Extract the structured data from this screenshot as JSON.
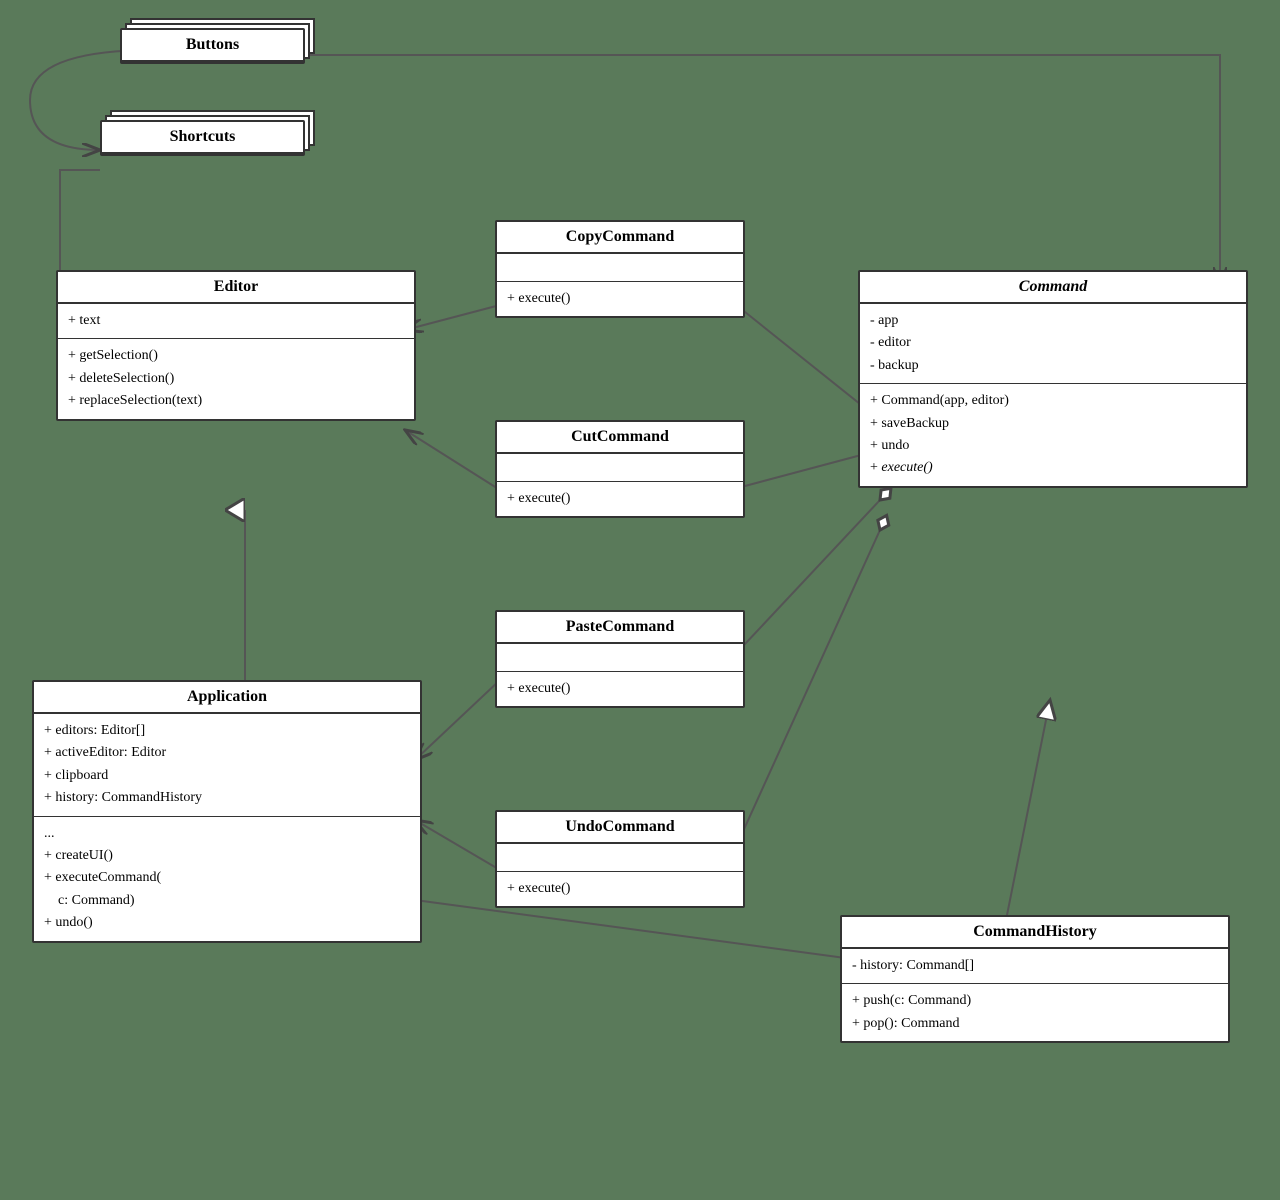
{
  "boxes": {
    "buttons": {
      "label": "Buttons"
    },
    "shortcuts": {
      "label": "Shortcuts"
    },
    "editor": {
      "label": "Editor",
      "section1": [
        "+ text"
      ],
      "section2": [
        "+ getSelection()",
        "+ deleteSelection()",
        "+ replaceSelection(text)"
      ]
    },
    "application": {
      "label": "Application",
      "section1": [
        "+ editors: Editor[]",
        "+ activeEditor: Editor",
        "+ clipboard",
        "+ history: CommandHistory"
      ],
      "section2": [
        "...",
        "+ createUI()",
        "+ executeCommand(",
        "    c: Command)",
        "+ undo()"
      ]
    },
    "copyCommand": {
      "label": "CopyCommand",
      "section1": [],
      "section2": [
        "+ execute()"
      ]
    },
    "cutCommand": {
      "label": "CutCommand",
      "section1": [],
      "section2": [
        "+ execute()"
      ]
    },
    "pasteCommand": {
      "label": "PasteCommand",
      "section1": [],
      "section2": [
        "+ execute()"
      ]
    },
    "undoCommand": {
      "label": "UndoCommand",
      "section1": [],
      "section2": [
        "+ execute()"
      ]
    },
    "command": {
      "label": "Command",
      "section1": [
        "- app",
        "- editor",
        "- backup"
      ],
      "section2": [
        "+ Command(app, editor)",
        "+ saveBackup",
        "+ undo",
        "+ execute()"
      ]
    },
    "commandHistory": {
      "label": "CommandHistory",
      "section1": [
        "- history: Command[]"
      ],
      "section2": [
        "+ push(c: Command)",
        "+ pop(): Command"
      ]
    }
  }
}
